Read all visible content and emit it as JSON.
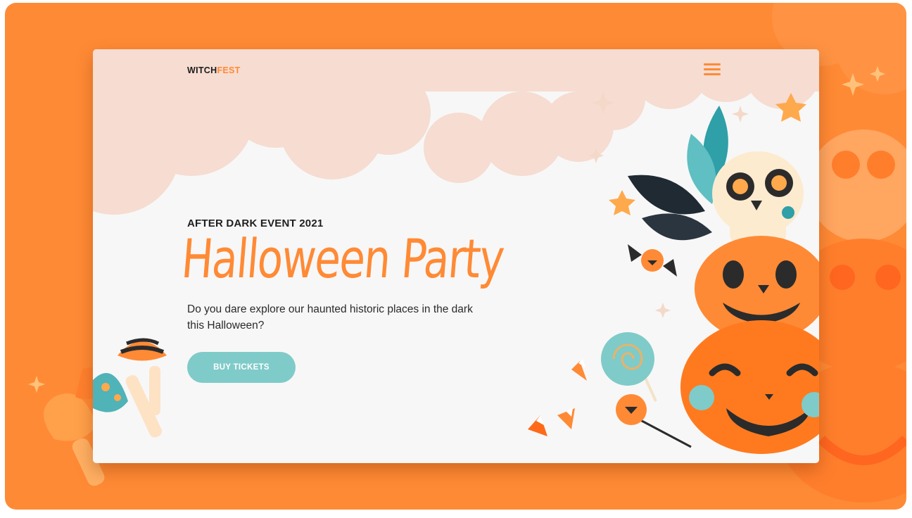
{
  "brand": {
    "part1": "WITCH",
    "part2": "FEST"
  },
  "nav": {
    "menu_icon": "hamburger-menu-icon"
  },
  "hero": {
    "eyebrow": "AFTER DARK EVENT 2021",
    "title": "Halloween Party",
    "description": "Do you dare explore our haunted historic places in the dark this Halloween?",
    "cta_label": "BUY TICKETS"
  },
  "colors": {
    "accent": "#ff8a35",
    "button": "#7fcbc9",
    "cloud": "#f6dcd1",
    "card_bg": "#f7f7f7",
    "text": "#1f1f1f"
  },
  "decorations": [
    "jack-o-lantern-icon",
    "skull-icon",
    "candy-corn-icon",
    "lollipop-icon",
    "mushroom-icon",
    "star-icon",
    "wrapped-candy-icon",
    "leaves-icon"
  ]
}
